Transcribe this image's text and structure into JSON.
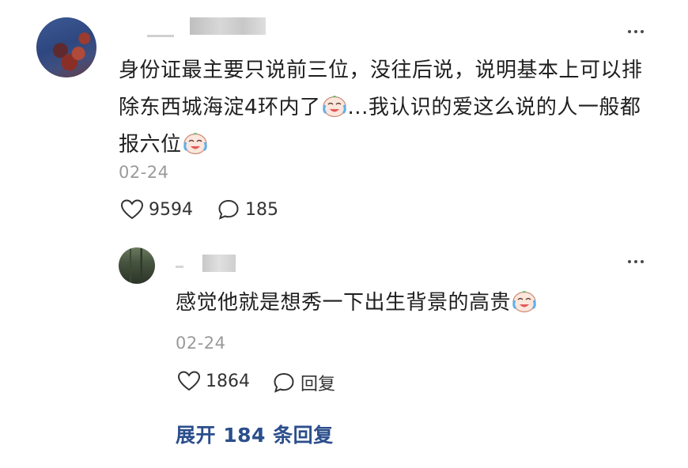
{
  "comment": {
    "text_part1": "身份证最主要只说前三位，没往后说，说明基本上可以排除东西城海淀4环内了",
    "text_part2": "...我认识的爱这么说的人一般都报六位",
    "date": "02-24",
    "like_count": "9594",
    "reply_count": "185",
    "emoji_name": "crying-laugh-emoji"
  },
  "reply": {
    "text": "感觉他就是想秀一下出生背景的高贵",
    "date": "02-24",
    "like_count": "1864",
    "reply_label": "回复"
  },
  "expand_label": "展开 184 条回复",
  "colors": {
    "link": "#2b4e8c",
    "meta": "#9a9a9a",
    "text": "#1f1f1f"
  }
}
